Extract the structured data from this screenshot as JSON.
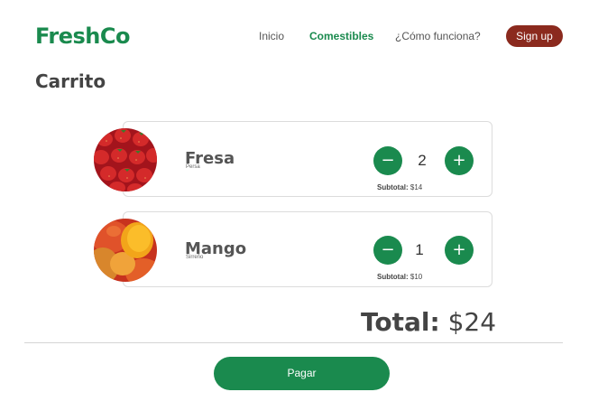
{
  "brand": {
    "name": "FreshCo"
  },
  "nav": {
    "inicio": "Inicio",
    "comestibles": "Comestibles",
    "como": "¿Cómo funciona?",
    "signup": "Sign up"
  },
  "page": {
    "title": "Carrito"
  },
  "cart": {
    "items": [
      {
        "name": "Fresa",
        "variety": "Persa",
        "minus": "−",
        "plus": "+",
        "quantity": "2",
        "subtotal_label": "Subtotal:",
        "subtotal_value": "$14"
      },
      {
        "name": "Mango",
        "variety": "Sirreño",
        "minus": "−",
        "plus": "+",
        "quantity": "1",
        "subtotal_label": "Subtotal:",
        "subtotal_value": "$10"
      }
    ],
    "total_label": "Total:",
    "total_value": "$24",
    "pay_label": "Pagar"
  },
  "colors": {
    "brand": "#1a8a4e",
    "signup": "#8b2a1e"
  },
  "icons": {
    "minus": "minus-icon",
    "plus": "plus-icon"
  }
}
